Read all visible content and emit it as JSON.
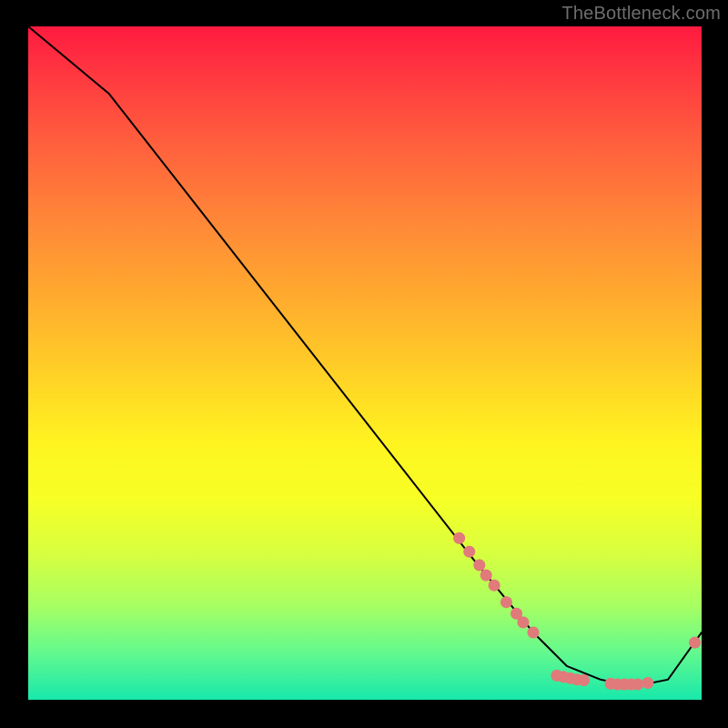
{
  "watermark": "TheBottleneck.com",
  "chart_data": {
    "type": "line",
    "title": "",
    "xlabel": "",
    "ylabel": "",
    "xlim": [
      0,
      100
    ],
    "ylim": [
      0,
      100
    ],
    "gradient_orientation": "vertical",
    "gradient_stops": [
      {
        "pos": 0,
        "color": "#ff1a3f"
      },
      {
        "pos": 6,
        "color": "#ff3340"
      },
      {
        "pos": 16,
        "color": "#ff5a3e"
      },
      {
        "pos": 28,
        "color": "#ff8438"
      },
      {
        "pos": 40,
        "color": "#ffaa2e"
      },
      {
        "pos": 52,
        "color": "#ffd226"
      },
      {
        "pos": 62,
        "color": "#fff420"
      },
      {
        "pos": 70,
        "color": "#f7ff25"
      },
      {
        "pos": 78,
        "color": "#d9ff3e"
      },
      {
        "pos": 86,
        "color": "#a7ff62"
      },
      {
        "pos": 93,
        "color": "#63f98e"
      },
      {
        "pos": 100,
        "color": "#18e8ab"
      }
    ],
    "series": [
      {
        "name": "curve",
        "color": "#000000",
        "weight": 2,
        "x": [
          0,
          12,
          66,
          75,
          80,
          85,
          90,
          95,
          100
        ],
        "y": [
          100,
          90,
          21,
          10,
          5,
          3,
          2,
          3,
          10
        ]
      }
    ],
    "markers": {
      "color": "#e17a7a",
      "radius": 6.5,
      "points": [
        {
          "x": 64.0,
          "y": 24.0
        },
        {
          "x": 65.5,
          "y": 22.0
        },
        {
          "x": 67.0,
          "y": 20.0
        },
        {
          "x": 68.0,
          "y": 18.5
        },
        {
          "x": 69.2,
          "y": 17.0
        },
        {
          "x": 71.0,
          "y": 14.5
        },
        {
          "x": 72.5,
          "y": 12.8
        },
        {
          "x": 73.5,
          "y": 11.5
        },
        {
          "x": 75.0,
          "y": 10.0
        },
        {
          "x": 78.5,
          "y": 3.6
        },
        {
          "x": 79.5,
          "y": 3.4
        },
        {
          "x": 80.5,
          "y": 3.2
        },
        {
          "x": 81.5,
          "y": 3.0
        },
        {
          "x": 82.5,
          "y": 2.9
        },
        {
          "x": 86.5,
          "y": 2.4
        },
        {
          "x": 87.5,
          "y": 2.3
        },
        {
          "x": 88.5,
          "y": 2.3
        },
        {
          "x": 89.5,
          "y": 2.3
        },
        {
          "x": 90.5,
          "y": 2.3
        },
        {
          "x": 92.0,
          "y": 2.5
        },
        {
          "x": 99.0,
          "y": 8.5
        }
      ]
    }
  }
}
